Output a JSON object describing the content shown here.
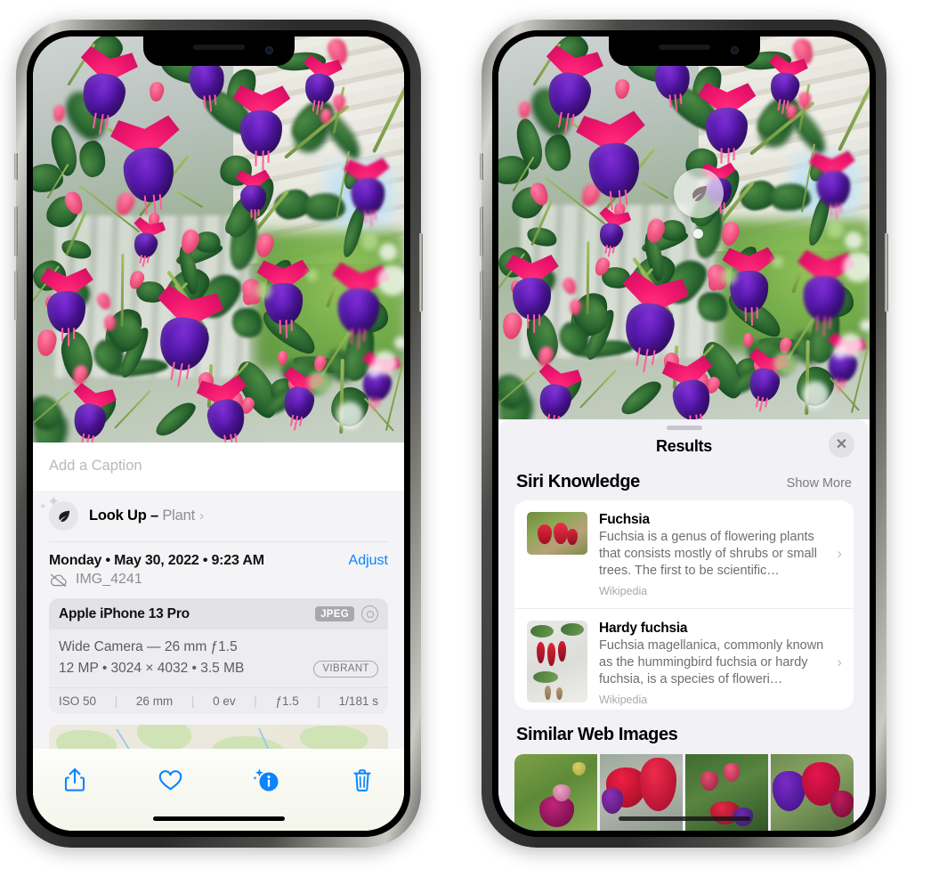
{
  "left_phone": {
    "caption": {
      "placeholder": "Add a Caption",
      "value": ""
    },
    "lookup": {
      "icon": "leaf-icon",
      "label": "Look Up",
      "dash": "–",
      "kind": "Plant",
      "chevron": "›"
    },
    "date_row": {
      "date": "Monday • May 30, 2022 • 9:23 AM",
      "adjust_label": "Adjust"
    },
    "file_row": {
      "icon": "icloud-slash-icon",
      "filename": "IMG_4241"
    },
    "metadata": {
      "device": "Apple iPhone 13 Pro",
      "format_badge": "JPEG",
      "hdr_icon": "hdr-ring-icon",
      "lens_line": "Wide Camera — 26 mm ƒ1.5",
      "size_line": "12 MP • 3024 × 4032 • 3.5 MB",
      "style_badge": "VIBRANT",
      "exif": [
        {
          "label": "ISO 50"
        },
        {
          "label": "26 mm"
        },
        {
          "label": "0 ev"
        },
        {
          "label": "ƒ1.5"
        },
        {
          "label": "1/181 s"
        }
      ],
      "exif_separator": "|"
    },
    "toolbar": [
      {
        "name": "share-icon",
        "label": "Share"
      },
      {
        "name": "heart-icon",
        "label": "Favorite"
      },
      {
        "name": "info-sparkle-icon",
        "label": "Info"
      },
      {
        "name": "trash-icon",
        "label": "Delete"
      }
    ]
  },
  "right_phone": {
    "photo_badge": {
      "icon": "leaf-icon",
      "label": "Plant identified"
    },
    "sheet": {
      "grabber": "drag-handle",
      "title": "Results",
      "close_icon": "✕"
    },
    "siri_knowledge": {
      "title": "Siri Knowledge",
      "show_more": "Show More",
      "items": [
        {
          "title": "Fuchsia",
          "description": "Fuchsia is a genus of flowering plants that consists mostly of shrubs or small trees. The first to be scientific…",
          "source": "Wikipedia",
          "chevron": "›"
        },
        {
          "title": "Hardy fuchsia",
          "description": "Fuchsia magellanica, commonly known as the hummingbird fuchsia or hardy fuchsia, is a species of floweri…",
          "source": "Wikipedia",
          "chevron": "›"
        }
      ]
    },
    "similar_web_images": {
      "title": "Similar Web Images",
      "thumbnails": [
        {
          "alt": "pink and magenta fuchsia with green leaves"
        },
        {
          "alt": "red fuchsia blossoms close up"
        },
        {
          "alt": "fuchsia buds on a green bush"
        },
        {
          "alt": "purple and magenta double fuchsia"
        }
      ]
    }
  },
  "colors": {
    "accent_blue": "#0a84ff",
    "sheet_bg": "#f2f1f6",
    "info_bg": "#f4f4f6",
    "card_bg": "#ffffff",
    "meta_card": "#edecef",
    "meta_head": "#e3e2e6",
    "muted_text": "#8e8e93"
  }
}
